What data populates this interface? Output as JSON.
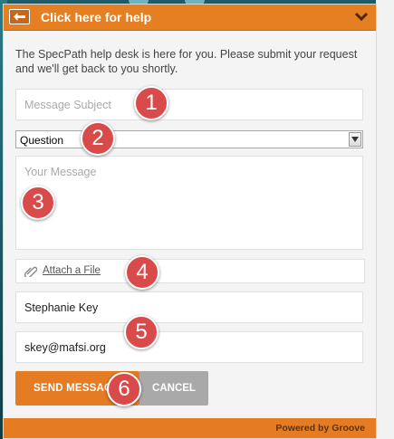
{
  "header": {
    "title": "Click here for help",
    "back_icon": "arrow-left-icon",
    "collapse_icon": "chevron-down-icon"
  },
  "intro": {
    "text": "The SpecPath help desk is here for you. Please submit your request and we'll get back to you shortly."
  },
  "form": {
    "subject_placeholder": "Message Subject",
    "category_selected": "Question",
    "message_placeholder": "Your Message",
    "attach_label": "Attach a File",
    "name_value": "Stephanie Key",
    "email_value": "skey@mafsi.org"
  },
  "buttons": {
    "send_label": "SEND MESSAGE",
    "cancel_label": "CANCEL"
  },
  "footer": {
    "text": "Powered by Groove"
  },
  "markers": [
    "1",
    "2",
    "3",
    "4",
    "5",
    "6"
  ],
  "colors": {
    "accent": "#e67e22",
    "marker": "#d94a4a",
    "cancel": "#a9a9a9"
  }
}
